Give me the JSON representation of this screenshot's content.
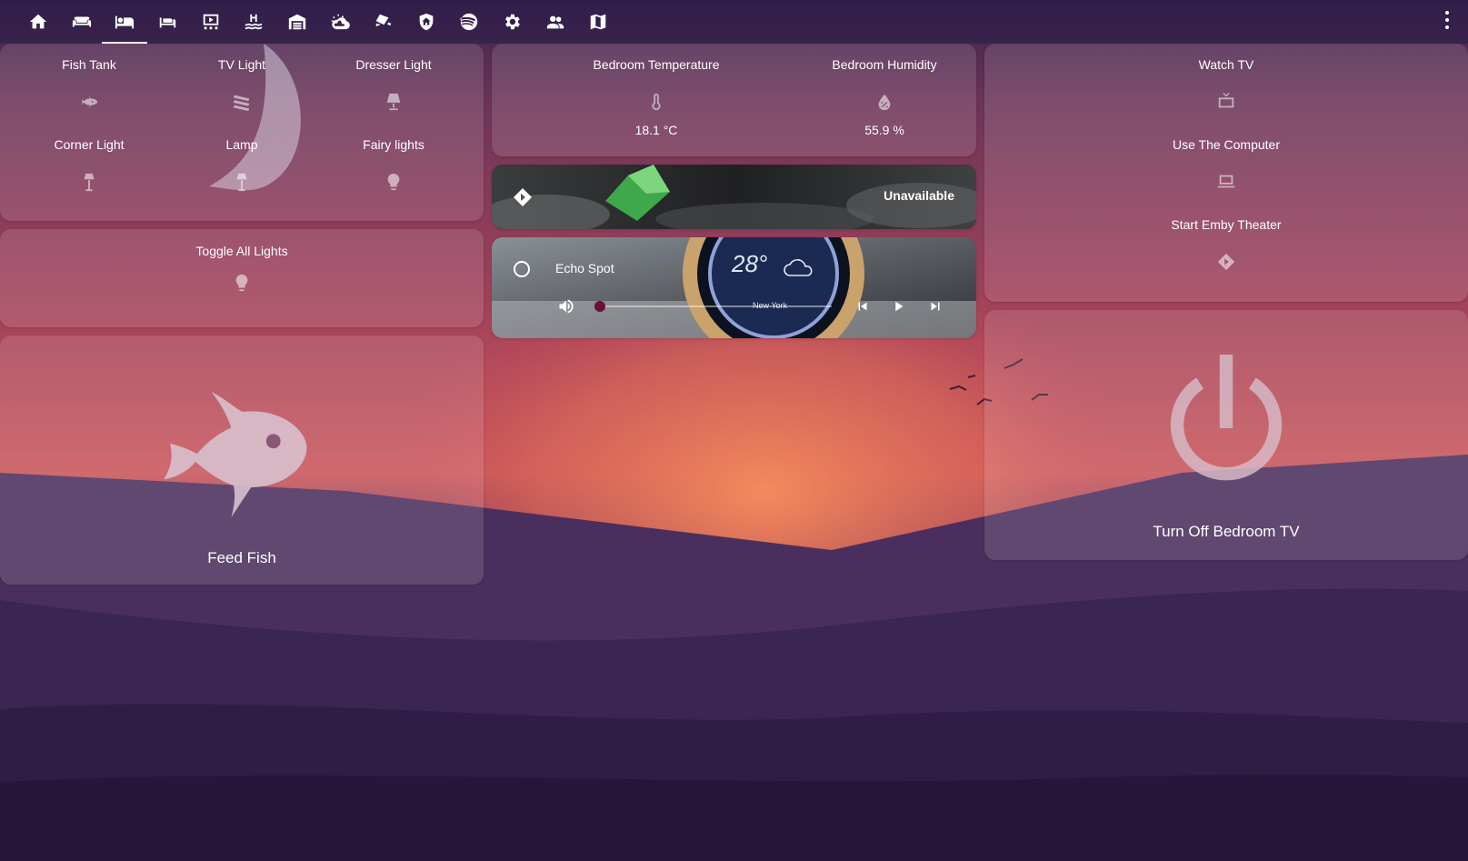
{
  "nav": {
    "tabs": [
      {
        "icon": "home-icon"
      },
      {
        "icon": "sofa-icon"
      },
      {
        "icon": "bed-icon",
        "active": true
      },
      {
        "icon": "bed-single-icon"
      },
      {
        "icon": "theater-icon"
      },
      {
        "icon": "pool-icon"
      },
      {
        "icon": "garage-icon"
      },
      {
        "icon": "weather-night-icon"
      },
      {
        "icon": "cctv-icon"
      },
      {
        "icon": "shield-home-icon"
      },
      {
        "icon": "spotify-icon"
      },
      {
        "icon": "settings-icon"
      },
      {
        "icon": "people-icon"
      },
      {
        "icon": "map-icon"
      }
    ]
  },
  "lights": {
    "fish_tank": "Fish Tank",
    "tv_light": "TV Light",
    "dresser_light": "Dresser Light",
    "corner_light": "Corner Light",
    "lamp": "Lamp",
    "fairy_lights": "Fairy lights"
  },
  "toggle_all": {
    "label": "Toggle All Lights"
  },
  "feed_fish": {
    "label": "Feed Fish"
  },
  "sensors": {
    "temperature": {
      "label": "Bedroom Temperature",
      "value": "18.1 °C"
    },
    "humidity": {
      "label": "Bedroom Humidity",
      "value": "55.9 %"
    }
  },
  "emby": {
    "status": "Unavailable"
  },
  "media": {
    "name": "Echo Spot",
    "progress": 0,
    "screen_temp": "28°",
    "screen_city": "New York"
  },
  "scenes": {
    "watch_tv": "Watch TV",
    "use_computer": "Use The Computer",
    "start_emby": "Start Emby Theater"
  },
  "tv_off": {
    "label": "Turn Off Bedroom TV"
  },
  "colors": {
    "accent": "#ffffff",
    "slider_knob": "#6b0f3a"
  }
}
